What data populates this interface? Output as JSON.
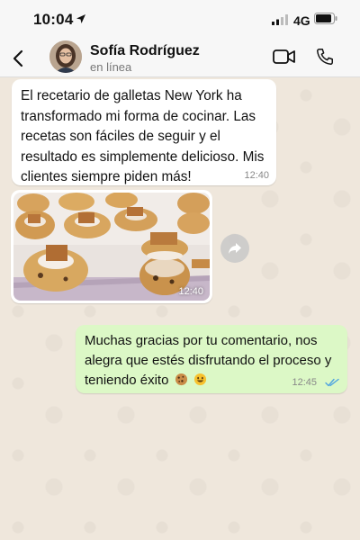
{
  "status_bar": {
    "time": "10:04",
    "network": "4G"
  },
  "header": {
    "contact_name": "Sofía Rodríguez",
    "contact_status": "en línea"
  },
  "messages": [
    {
      "direction": "incoming",
      "text": "El recetario de galletas New York ha transformado mi forma de cocinar. Las recetas son fáciles de seguir y el resultado es simplemente delicioso. Mis clientes siempre piden más!",
      "time": "12:40"
    },
    {
      "direction": "incoming",
      "type": "image",
      "image_subject": "cookies-photo",
      "time": "12:40"
    },
    {
      "direction": "outgoing",
      "text": "Muchas gracias por tu comentario, nos alegra que estés disfrutando el proceso y teniendo éxito",
      "emojis": [
        "cookie-emoji",
        "smile-emoji"
      ],
      "time": "12:45",
      "status": "read"
    }
  ],
  "colors": {
    "chat_background": "#efe7dc",
    "incoming_bubble": "#ffffff",
    "outgoing_bubble": "#dcf8c6",
    "read_ticks": "#4fa3e0"
  }
}
